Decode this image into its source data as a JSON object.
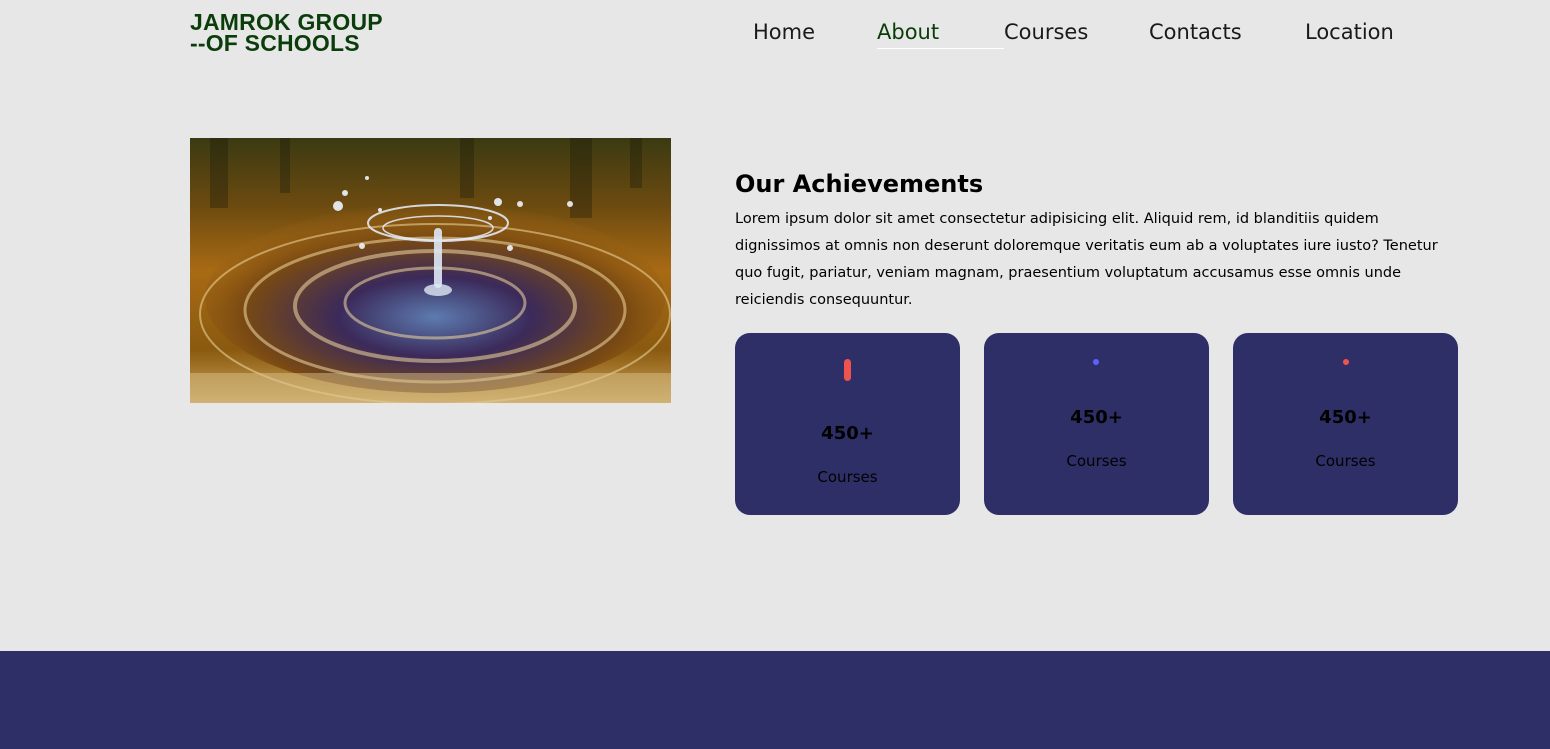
{
  "header": {
    "logo_line1": "JAMROK GROUP",
    "logo_line2": "--OF SCHOOLS",
    "nav": [
      {
        "label": "Home"
      },
      {
        "label": "About"
      },
      {
        "label": "Courses"
      },
      {
        "label": "Contacts"
      },
      {
        "label": "Location"
      }
    ],
    "active_nav": "About"
  },
  "about": {
    "image_alt": "water-drop-splash-image",
    "title": "Our Achievements",
    "body": "Lorem ipsum dolor sit amet consectetur adipisicing elit. Aliquid rem, id blanditiis quidem dignissimos at omnis non deserunt doloremque veritatis eum ab a voluptates iure iusto? Tenetur quo fugit, pariatur, veniam magnam, praesentium voluptatum accusamus esse omnis unde reiciendis consequuntur."
  },
  "stats": [
    {
      "value": "450+",
      "label": "Courses",
      "icon": "red-bar-icon",
      "color": "#ef5350"
    },
    {
      "value": "450+",
      "label": "Courses",
      "icon": "blue-dot-icon",
      "color": "#5b63ff"
    },
    {
      "value": "450+",
      "label": "Courses",
      "icon": "red-dot-icon",
      "color": "#ef5350"
    }
  ],
  "colors": {
    "background": "#e7e7e7",
    "brand_green": "#0b3d0b",
    "card_navy": "#2e2f66",
    "footer_navy": "#2e2f66"
  }
}
